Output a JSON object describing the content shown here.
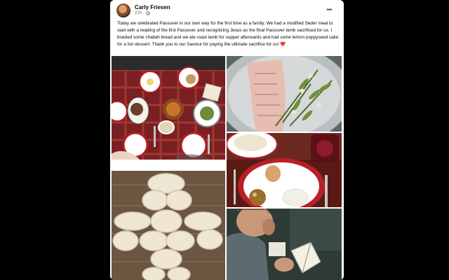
{
  "post": {
    "author": "Carly Friesen",
    "time": "21h",
    "caption": "Today we celebrated Passover in our own way for the first time as a family. We had a modified Seder meal to start with a reading of the first Passover and recognizing Jesus as the final Passover lamb sacrificed for us. I braided some challah bread and we ate roast lamb for supper afterwards and had some lemon poppyseed cake for a fun dessert. Thank you to our Saviour for paying the ultimate sacrifice for us! ",
    "caption_emoji": "❤️",
    "more_icon": "more-horizontal-icon",
    "privacy_icon": "globe-icon"
  },
  "colors": {
    "background": "#000000",
    "card": "#ffffff",
    "heart": "#e41e3f",
    "meta_text": "#65676b"
  },
  "photos": [
    {
      "id": "seder-table"
    },
    {
      "id": "roast-lamb-herbs"
    },
    {
      "id": "seder-plate"
    },
    {
      "id": "braided-challah"
    },
    {
      "id": "man-reading-book"
    }
  ]
}
